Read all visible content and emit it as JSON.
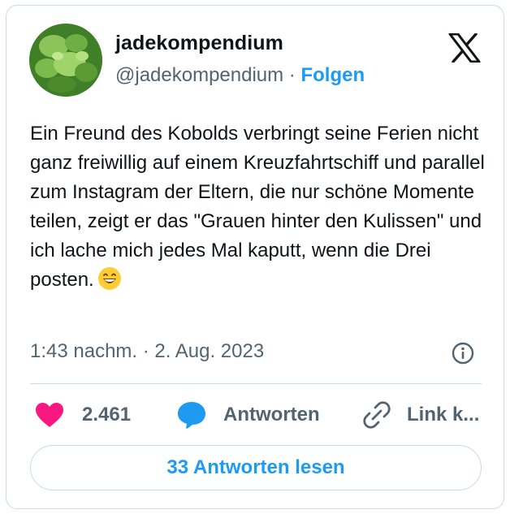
{
  "author": {
    "display_name": "jadekompendium",
    "handle": "@jadekompendium",
    "separator": " · ",
    "follow_label": "Folgen"
  },
  "tweet": {
    "text": "Ein Freund des Kobolds verbringt seine Ferien nicht ganz freiwillig auf einem Kreuzfahrtschiff und parallel zum Instagram der Eltern, die nur schöne Momente teilen, zeigt er das \"Grauen hinter den Kulissen\" und ich lache mich jedes Mal kaputt, wenn die Drei posten.",
    "emoji": "grinning-face-emoji",
    "timestamp": "1:43 nachm. · 2. Aug. 2023"
  },
  "actions": {
    "likes": "2.461",
    "reply_label": "Antworten",
    "link_label": "Link k..."
  },
  "read_replies_label": "33 Antworten lesen",
  "icons": {
    "brand": "x-logo-icon",
    "info": "info-icon",
    "heart": "heart-icon",
    "reply": "speech-bubble-icon",
    "link": "link-icon"
  },
  "colors": {
    "accent": "#1d9bf0",
    "like": "#f91880",
    "text": "#0f1419",
    "muted": "#536471",
    "border": "#cfd9de"
  }
}
